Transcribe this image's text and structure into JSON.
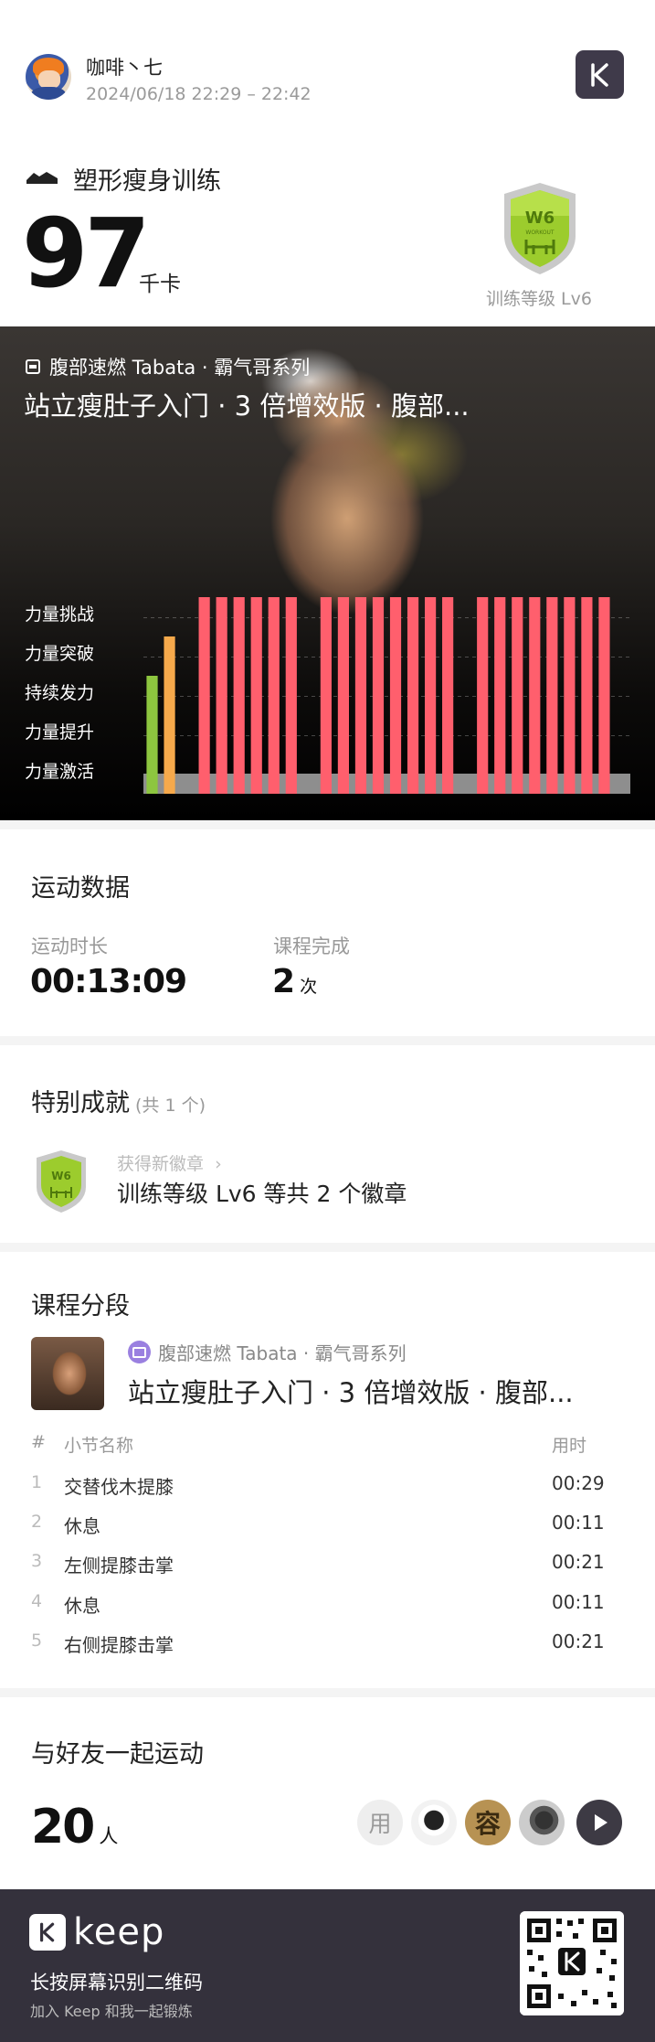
{
  "header": {
    "username": "咖啡丶七",
    "time_range": "2024/06/18 22:29 – 22:42",
    "workout_type": "塑形瘦身训练",
    "calories": "97",
    "calories_unit": "千卡",
    "level_label": "训练等级 Lv6",
    "badge_text": "W6",
    "badge_sub": "WORKOUT"
  },
  "hero": {
    "series": "腹部速燃 Tabata · 霸气哥系列",
    "title": "站立瘦肚子入门 · 3 倍增效版 · 腹部...",
    "intensity_levels": [
      "力量挑战",
      "力量突破",
      "持续发力",
      "力量提升",
      "力量激活"
    ]
  },
  "chart_data": {
    "type": "bar",
    "title": "",
    "xlabel": "",
    "ylabel": "",
    "y_categories": [
      "力量激活",
      "力量提升",
      "持续发力",
      "力量突破",
      "力量挑战"
    ],
    "values": [
      3,
      4,
      0,
      5,
      5,
      5,
      5,
      5,
      5,
      0,
      5,
      5,
      5,
      5,
      5,
      5,
      5,
      5,
      0,
      5,
      5,
      5,
      5,
      5,
      5,
      5,
      5,
      0
    ],
    "bar_colors": {
      "3": "#8dc63f",
      "4": "#f6a94b",
      "5": "#ff5f6d",
      "0": "#8e8e8e"
    },
    "baseline_color": "#8e8e8e",
    "grid": "dashed horizontal"
  },
  "stats": {
    "section_title": "运动数据",
    "duration_label": "运动时长",
    "duration_value": "00:13:09",
    "completion_label": "课程完成",
    "completion_value": "2",
    "completion_unit": "次"
  },
  "achievements": {
    "section_title": "特别成就",
    "count_note": "(共 1 个)",
    "sub_label": "获得新徽章",
    "main_label": "训练等级 Lv6 等共 2 个徽章"
  },
  "segments": {
    "section_title": "课程分段",
    "series": "腹部速燃 Tabata · 霸气哥系列",
    "title": "站立瘦肚子入门 · 3 倍增效版 · 腹部...",
    "col_index": "#",
    "col_name": "小节名称",
    "col_time": "用时",
    "rows": [
      {
        "idx": "1",
        "name": "交替伐木提膝",
        "time": "00:29"
      },
      {
        "idx": "2",
        "name": "休息",
        "time": "00:11"
      },
      {
        "idx": "3",
        "name": "左侧提膝击掌",
        "time": "00:21"
      },
      {
        "idx": "4",
        "name": "休息",
        "time": "00:11"
      },
      {
        "idx": "5",
        "name": "右侧提膝击掌",
        "time": "00:21"
      }
    ]
  },
  "friends": {
    "section_title": "与好友一起运动",
    "count": "20",
    "unit": "人",
    "used_label": "用",
    "avatar3_char": "容"
  },
  "footer": {
    "brand": "keep",
    "scan_text": "长按屏幕识别二维码",
    "join_text": "加入 Keep 和我一起锻炼"
  },
  "colors": {
    "dark": "#3f3a4a",
    "green": "#8dc63f",
    "orange": "#f6a94b",
    "red": "#ff5f6d",
    "gray": "#8e8e8e"
  }
}
